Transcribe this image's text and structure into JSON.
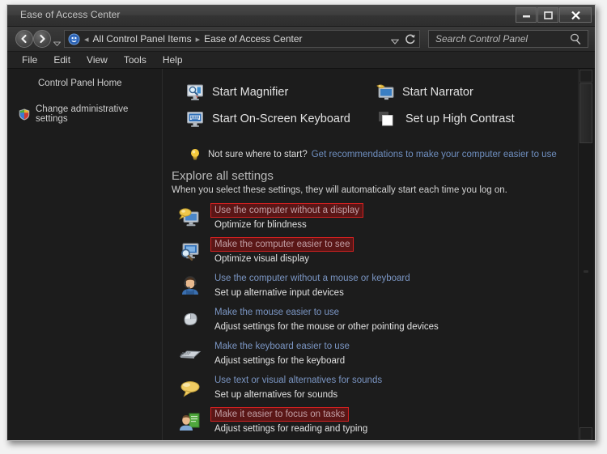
{
  "window": {
    "title": "Ease of Access Center",
    "controls": {
      "minimize": "minimize-button",
      "maximize": "maximize-button",
      "close": "close-button"
    }
  },
  "address_bar": {
    "back": "back-button",
    "forward": "forward-button",
    "history_dropdown": "history-dropdown",
    "breadcrumbs": [
      {
        "label": "All Control Panel Items"
      },
      {
        "label": "Ease of Access Center"
      }
    ],
    "dropdown_icon": "chevron-down-icon",
    "refresh_icon": "refresh-icon"
  },
  "search": {
    "placeholder": "Search Control Panel",
    "value": "",
    "icon": "search-icon"
  },
  "menu": {
    "items": [
      {
        "label": "File"
      },
      {
        "label": "Edit"
      },
      {
        "label": "View"
      },
      {
        "label": "Tools"
      },
      {
        "label": "Help"
      }
    ]
  },
  "sidebar": {
    "home_label": "Control Panel Home",
    "admin_label": "Change administrative settings",
    "admin_icon": "shield-icon"
  },
  "quick_access": [
    {
      "label": "Start Magnifier",
      "icon": "magnifier-monitor-icon"
    },
    {
      "label": "Start Narrator",
      "icon": "narrator-monitor-icon"
    },
    {
      "label": "Start On-Screen Keyboard",
      "icon": "onscreen-keyboard-icon"
    },
    {
      "label": "Set up High Contrast",
      "icon": "high-contrast-icon"
    }
  ],
  "hint": {
    "icon": "lightbulb-icon",
    "question": "Not sure where to start?",
    "link": "Get recommendations to make your computer easier to use"
  },
  "explore": {
    "title": "Explore all settings",
    "subtitle": "When you select these settings, they will automatically start each time you log on."
  },
  "settings": [
    {
      "link": "Use the computer without a display",
      "desc": "Optimize for blindness",
      "icon": "monitor-speech-icon",
      "highlighted": true
    },
    {
      "link": "Make the computer easier to see",
      "desc": "Optimize visual display",
      "icon": "monitor-magnifier-icon",
      "highlighted": true
    },
    {
      "link": "Use the computer without a mouse or keyboard",
      "desc": "Set up alternative input devices",
      "icon": "person-headset-icon",
      "highlighted": false
    },
    {
      "link": "Make the mouse easier to use",
      "desc": "Adjust settings for the mouse or other pointing devices",
      "icon": "mouse-icon",
      "highlighted": false
    },
    {
      "link": "Make the keyboard easier to use",
      "desc": "Adjust settings for the keyboard",
      "icon": "keyboard-icon",
      "highlighted": false
    },
    {
      "link": "Use text or visual alternatives for sounds",
      "desc": "Set up alternatives for sounds",
      "icon": "speech-bubble-icon",
      "highlighted": false
    },
    {
      "link": "Make it easier to focus on tasks",
      "desc": "Adjust settings for reading and typing",
      "icon": "person-document-icon",
      "highlighted": true
    }
  ],
  "colors": {
    "highlight_fill": "#5a1616",
    "highlight_border": "#d42020",
    "link": "#7b96c4",
    "window_bg": "#1c1c1c"
  }
}
